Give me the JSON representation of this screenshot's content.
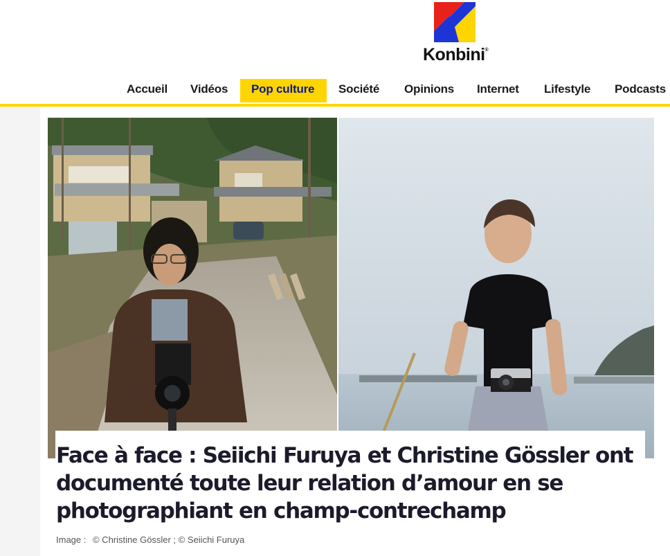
{
  "brand": {
    "name": "Konbini",
    "registered": "®",
    "colors": {
      "accent": "#ffd500",
      "red": "#e8221b",
      "blue": "#1d35d6",
      "yellow": "#ffd500"
    }
  },
  "nav": {
    "items": [
      {
        "label": "Accueil",
        "active": false
      },
      {
        "label": "Vidéos",
        "active": false
      },
      {
        "label": "Pop culture",
        "active": true
      },
      {
        "label": "Société",
        "active": false
      },
      {
        "label": "Opinions",
        "active": false
      },
      {
        "label": "Internet",
        "active": false
      },
      {
        "label": "Lifestyle",
        "active": false
      },
      {
        "label": "Podcasts",
        "active": false
      }
    ]
  },
  "article": {
    "headline": "Face à face : Seiichi Furuya et Christine Gössler ont documenté toute leur relation d’amour en se photographiant en champ-contrechamp",
    "credit_label": "Image :",
    "credit_text": "© Christine Gössler ; © Seiichi Furuya"
  }
}
